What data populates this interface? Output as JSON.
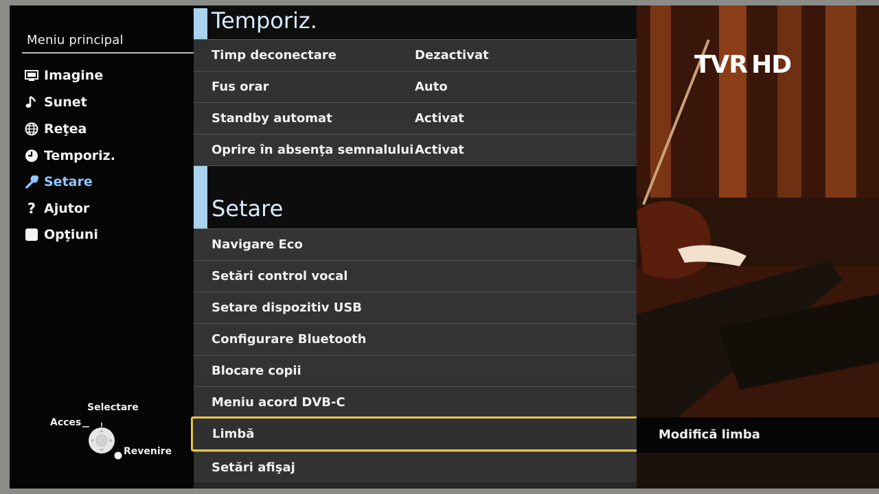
{
  "sidebar": {
    "title": "Meniu principal",
    "items": [
      {
        "label": "Imagine",
        "icon": "picture-icon"
      },
      {
        "label": "Sunet",
        "icon": "music-note-icon"
      },
      {
        "label": "Reţea",
        "icon": "globe-icon"
      },
      {
        "label": "Temporiz.",
        "icon": "clock-icon"
      },
      {
        "label": "Setare",
        "icon": "wrench-icon",
        "active": true
      },
      {
        "label": "Ajutor",
        "icon": "question-icon"
      },
      {
        "label": "Opţiuni",
        "icon": "square-icon"
      }
    ],
    "active_color": "#8ec7ff"
  },
  "nav_hint": {
    "acces": "Acces",
    "selectare": "Selectare",
    "revenire": "Revenire"
  },
  "sections": [
    {
      "title": "Temporiz.",
      "rows": [
        {
          "label": "Timp deconectare",
          "value": "Dezactivat"
        },
        {
          "label": "Fus orar",
          "value": "Auto"
        },
        {
          "label": "Standby automat",
          "value": "Activat"
        },
        {
          "label": "Oprire în absenţa semnalului",
          "value": "Activat"
        }
      ]
    },
    {
      "title": "Setare",
      "rows": [
        {
          "label": "Navigare Eco"
        },
        {
          "label": "Setări control vocal"
        },
        {
          "label": "Setare dispozitiv USB"
        },
        {
          "label": "Configurare Bluetooth"
        },
        {
          "label": "Blocare copii"
        },
        {
          "label": "Meniu acord DVB-C"
        },
        {
          "label": "Limbă",
          "selected": true
        },
        {
          "label": "Setări afişaj"
        }
      ]
    }
  ],
  "channel_logo": {
    "tvr": "TVR",
    "hd": "HD"
  },
  "help_text": "Modifică limba",
  "colors": {
    "accent_bar": "#a9d2ec",
    "selection": "#e8c64a",
    "section_title": "#d6ecff"
  }
}
